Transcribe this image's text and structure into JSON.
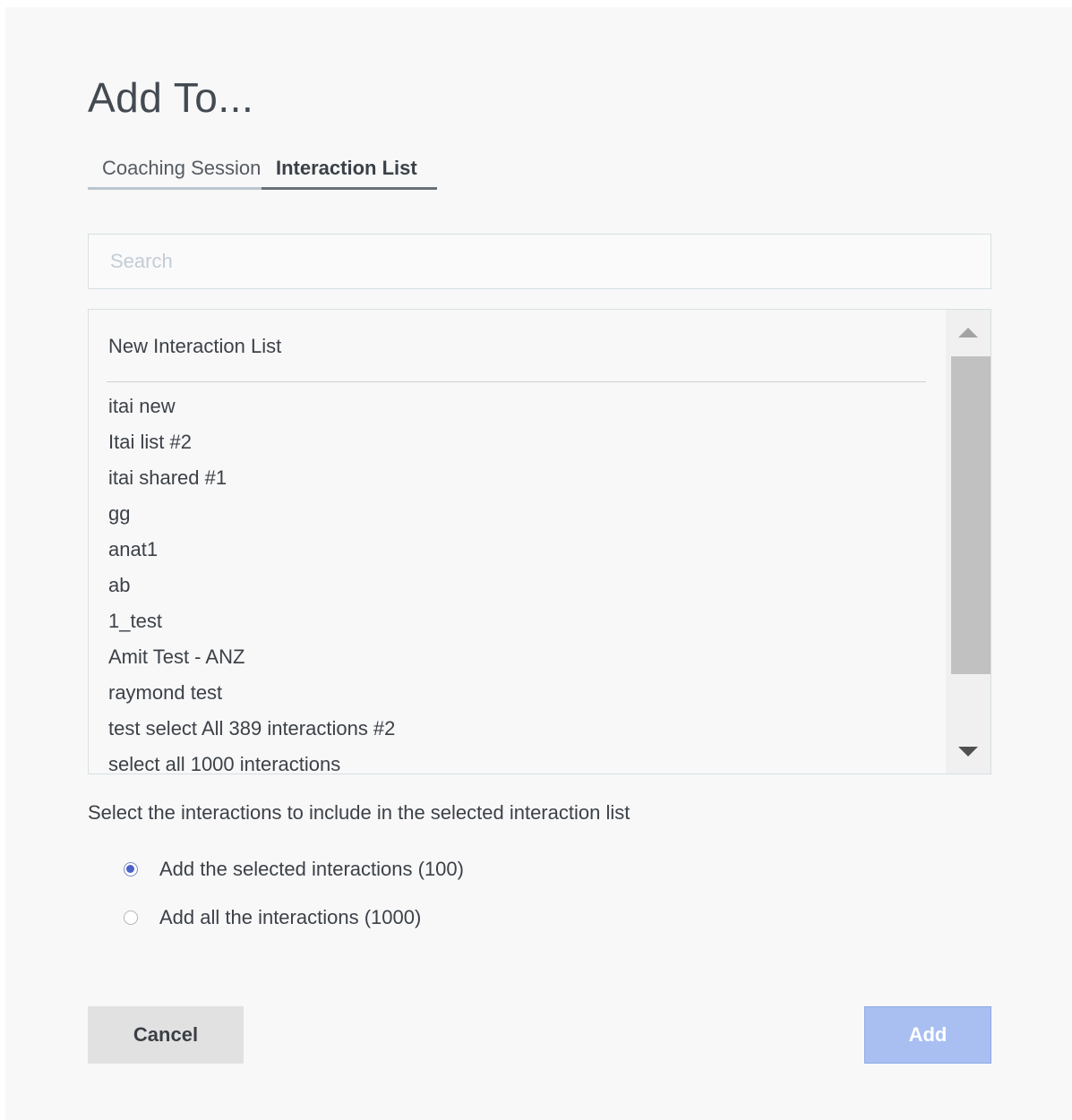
{
  "dialog": {
    "title": "Add To..."
  },
  "tabs": [
    {
      "label": "Coaching Session",
      "active": false
    },
    {
      "label": "Interaction List",
      "active": true
    }
  ],
  "search": {
    "placeholder": "Search",
    "value": ""
  },
  "list": {
    "header": "New Interaction List",
    "items": [
      "itai new",
      "Itai list #2",
      "itai shared #1",
      "gg",
      "anat1",
      "ab",
      "1_test",
      "Amit Test - ANZ",
      "raymond test",
      "test select All 389 interactions #2",
      "select all 1000 interactions"
    ]
  },
  "selection": {
    "instruction": "Select the interactions to include in the selected interaction list",
    "options": [
      {
        "label": "Add the selected interactions (100)",
        "checked": true
      },
      {
        "label": "Add all the interactions (1000)",
        "checked": false
      }
    ]
  },
  "buttons": {
    "cancel": "Cancel",
    "add": "Add"
  },
  "colors": {
    "accent": "#4a63c9",
    "add_button_disabled": "#a9bff2",
    "background": "#f8f8f8"
  },
  "icons": {
    "scroll_up": "triangle-up-icon",
    "scroll_down": "triangle-down-icon"
  }
}
